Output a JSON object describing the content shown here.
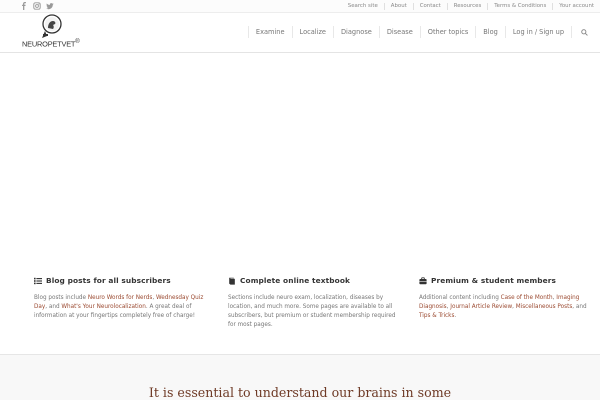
{
  "social": [
    {
      "icon": "facebook-icon"
    },
    {
      "icon": "instagram-icon"
    },
    {
      "icon": "twitter-icon"
    }
  ],
  "utility_nav": [
    "Search site",
    "About",
    "Contact",
    "Resources",
    "Terms & Conditions",
    "Your account"
  ],
  "logo": {
    "text": "NEUROPETVET",
    "mark": "®"
  },
  "main_nav": [
    "Examine",
    "Localize",
    "Diagnose",
    "Disease",
    "Other topics",
    "Blog",
    "Log in / Sign up"
  ],
  "columns": [
    {
      "icon": "list-icon",
      "title": "Blog posts for all subscribers",
      "body": [
        {
          "t": "Blog posts include ",
          "link": false
        },
        {
          "t": "Neuro Words for Nerds",
          "link": true
        },
        {
          "t": ", ",
          "link": false
        },
        {
          "t": "Wednesday Quiz Day",
          "link": true
        },
        {
          "t": ", and ",
          "link": false
        },
        {
          "t": "What's Your Neurolocalization",
          "link": true
        },
        {
          "t": ". A great deal of information at your fingertips completely free of charge!",
          "link": false
        }
      ]
    },
    {
      "icon": "book-icon",
      "title": "Complete online textbook",
      "body": [
        {
          "t": "Sections include neuro exam, localization, diseases by location, and much more. Some pages are available to all subscribers, but premium or student membership required for most pages.",
          "link": false
        }
      ]
    },
    {
      "icon": "briefcase-icon",
      "title": "Premium & student members",
      "body": [
        {
          "t": "Additional content including ",
          "link": false
        },
        {
          "t": "Case of the Month",
          "link": true
        },
        {
          "t": ", ",
          "link": false
        },
        {
          "t": "Imaging Diagnosis",
          "link": true
        },
        {
          "t": ", ",
          "link": false
        },
        {
          "t": "Journal Article Review",
          "link": true
        },
        {
          "t": ", ",
          "link": false
        },
        {
          "t": "Miscellaneous Posts",
          "link": true
        },
        {
          "t": ", and ",
          "link": false
        },
        {
          "t": "Tips & Tricks",
          "link": true
        },
        {
          "t": ".",
          "link": false
        }
      ]
    }
  ],
  "band": {
    "headline": "It is essential to understand our brains in some"
  },
  "colors": {
    "accent": "#9b4a31",
    "headline": "#6e3a26",
    "text": "#777777"
  }
}
